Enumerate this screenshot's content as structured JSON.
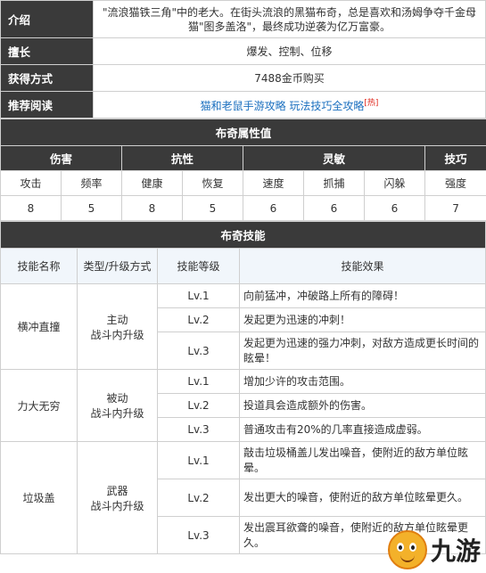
{
  "info": {
    "intro_label": "介绍",
    "intro_text": "\"流浪猫铁三角\"中的老大。在街头流浪的黑猫布奇，总是喜欢和汤姆争夺千金母猫\"图多盖洛\"，最终成功逆袭为亿万富豪。",
    "skill_label": "擅长",
    "skill_value": "爆发、控制、位移",
    "obtain_label": "获得方式",
    "obtain_value": "7488金币购买",
    "recommend_label": "推荐阅读",
    "recommend_link": "猫和老鼠手游攻略 玩法技巧全攻略",
    "recommend_hot": "[热]"
  },
  "attrs": {
    "title": "布奇属性值",
    "groups": [
      "伤害",
      "抗性",
      "灵敏",
      "技巧"
    ],
    "columns": [
      "攻击",
      "频率",
      "健康",
      "恢复",
      "速度",
      "抓捕",
      "闪躲",
      "强度"
    ],
    "values": [
      "8",
      "5",
      "8",
      "5",
      "6",
      "6",
      "6",
      "7"
    ]
  },
  "skills": {
    "title": "布奇技能",
    "headers": [
      "技能名称",
      "类型/升级方式",
      "技能等级",
      "技能效果"
    ],
    "rows": [
      {
        "name": "横冲直撞",
        "type": "主动",
        "upgrade": "战斗内升级",
        "levels": [
          {
            "lv": "Lv.1",
            "effect": "向前猛冲，冲破路上所有的障碍！"
          },
          {
            "lv": "Lv.2",
            "effect": "发起更为迅速的冲刺！"
          },
          {
            "lv": "Lv.3",
            "effect": "发起更为迅速的强力冲刺，对敌方造成更长时间的眩晕！"
          }
        ]
      },
      {
        "name": "力大无穷",
        "type": "被动",
        "upgrade": "战斗内升级",
        "levels": [
          {
            "lv": "Lv.1",
            "effect": "增加少许的攻击范围。"
          },
          {
            "lv": "Lv.2",
            "effect": "投道具会造成额外的伤害。"
          },
          {
            "lv": "Lv.3",
            "effect": "普通攻击有20%的几率直接造成虚弱。"
          }
        ]
      },
      {
        "name": "垃圾盖",
        "type": "武器",
        "upgrade": "战斗内升级",
        "levels": [
          {
            "lv": "Lv.1",
            "effect": "敲击垃圾桶盖儿发出噪音，使附近的敌方单位眩晕。"
          },
          {
            "lv": "Lv.2",
            "effect": "发出更大的噪音，使附近的敌方单位眩晕更久。"
          },
          {
            "lv": "Lv.3",
            "effect": "发出震耳欲聋的噪音，使附近的敌方单位眩晕更久。"
          }
        ]
      }
    ]
  },
  "watermark": {
    "text": "九游",
    "icon": "mascot-icon"
  }
}
